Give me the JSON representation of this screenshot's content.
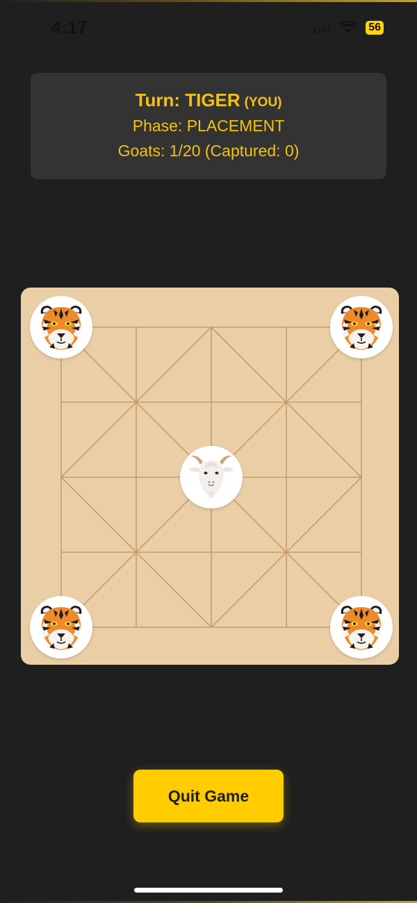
{
  "status_bar": {
    "time": "4:17",
    "battery": "56"
  },
  "info": {
    "turn_label": "Turn: TIGER",
    "turn_suffix": "(YOU)",
    "phase": "Phase: PLACEMENT",
    "goats": "Goats: 1/20 (Captured: 0)"
  },
  "board": {
    "grid_size": 5,
    "pieces": [
      {
        "type": "tiger",
        "row": 0,
        "col": 0
      },
      {
        "type": "tiger",
        "row": 0,
        "col": 4
      },
      {
        "type": "goat",
        "row": 2,
        "col": 2
      },
      {
        "type": "tiger",
        "row": 4,
        "col": 0
      },
      {
        "type": "tiger",
        "row": 4,
        "col": 4
      }
    ]
  },
  "actions": {
    "quit_label": "Quit Game"
  },
  "colors": {
    "accent": "#ffcc00",
    "text_accent": "#f4c20d",
    "panel": "#333333",
    "board": "#eacfa6",
    "lines": "#c69a6c"
  }
}
